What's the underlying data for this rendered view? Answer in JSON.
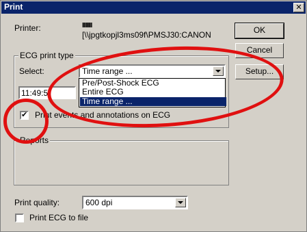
{
  "window": {
    "title": "Print",
    "close_glyph": "✕"
  },
  "printer": {
    "label": "Printer:",
    "name_line1": "IIIIIIII",
    "name_line2": "[\\\\jpgtkopjl3ms09f\\PMSJ30:CANON"
  },
  "buttons": {
    "ok": "OK",
    "cancel": "Cancel",
    "setup": "Setup..."
  },
  "ecg_print_type": {
    "legend": "ECG print type",
    "select_label": "Select:",
    "selected_value": "Time range ...",
    "options": [
      "Pre/Post-Shock ECG",
      "Entire ECG",
      "Time range ..."
    ],
    "time_value": "11:49:5"
  },
  "print_events": {
    "label": "Print events and annotations on ECG",
    "checked_glyph": "✔"
  },
  "reports": {
    "legend": "Reports"
  },
  "print_quality": {
    "label": "Print quality:",
    "value": "600 dpi"
  },
  "print_to_file": {
    "label": "Print ECG to file"
  },
  "colors": {
    "titlebar": "#0a246a",
    "highlight": "#0a246a",
    "annotation_red": "#e01010"
  }
}
